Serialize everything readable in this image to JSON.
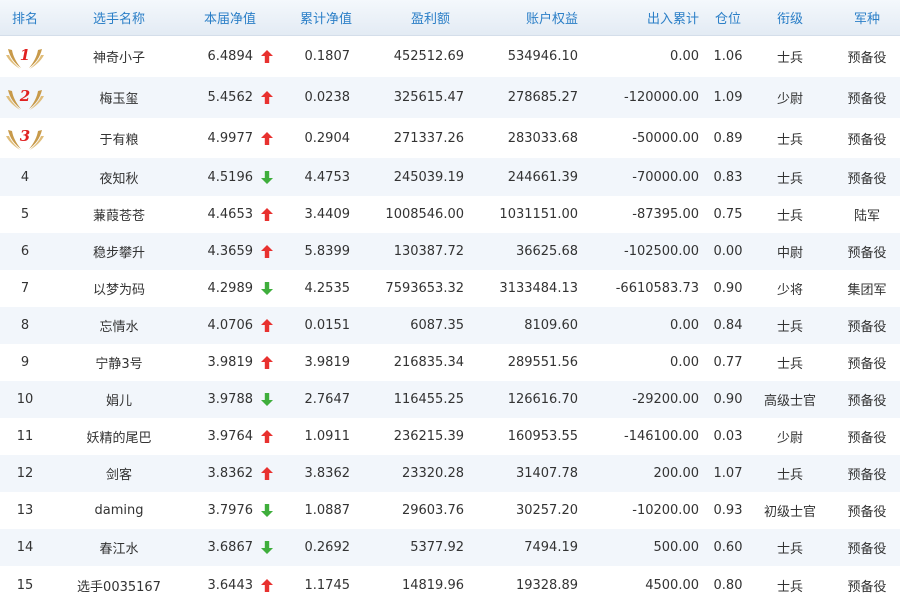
{
  "header": {
    "rank": "排名",
    "name": "选手名称",
    "nav": "本届净值",
    "cumulative_nav": "累计净值",
    "profit": "盈利额",
    "equity": "账户权益",
    "inout": "出入累计",
    "position": "仓位",
    "military_rank": "衔级",
    "army": "军种"
  },
  "colors": {
    "up": "#e8312f",
    "down": "#3fae3c",
    "header_text": "#2b7fc7",
    "medal_gold": "#c89a4a",
    "medal_number": "#e02020"
  },
  "rows": [
    {
      "rank": "1",
      "medal": true,
      "name": "神奇小子",
      "nav": "6.4894",
      "trend": "up",
      "cumulative_nav": "0.1807",
      "profit": "452512.69",
      "equity": "534946.10",
      "inout": "0.00",
      "position": "1.06",
      "military_rank": "士兵",
      "army": "预备役"
    },
    {
      "rank": "2",
      "medal": true,
      "name": "梅玉玺",
      "nav": "5.4562",
      "trend": "up",
      "cumulative_nav": "0.0238",
      "profit": "325615.47",
      "equity": "278685.27",
      "inout": "-120000.00",
      "position": "1.09",
      "military_rank": "少尉",
      "army": "预备役"
    },
    {
      "rank": "3",
      "medal": true,
      "name": "于有粮",
      "nav": "4.9977",
      "trend": "up",
      "cumulative_nav": "0.2904",
      "profit": "271337.26",
      "equity": "283033.68",
      "inout": "-50000.00",
      "position": "0.89",
      "military_rank": "士兵",
      "army": "预备役"
    },
    {
      "rank": "4",
      "medal": false,
      "name": "夜知秋",
      "nav": "4.5196",
      "trend": "down",
      "cumulative_nav": "4.4753",
      "profit": "245039.19",
      "equity": "244661.39",
      "inout": "-70000.00",
      "position": "0.83",
      "military_rank": "士兵",
      "army": "预备役"
    },
    {
      "rank": "5",
      "medal": false,
      "name": "蒹葭苍苍",
      "nav": "4.4653",
      "trend": "up",
      "cumulative_nav": "3.4409",
      "profit": "1008546.00",
      "equity": "1031151.00",
      "inout": "-87395.00",
      "position": "0.75",
      "military_rank": "士兵",
      "army": "陆军"
    },
    {
      "rank": "6",
      "medal": false,
      "name": "稳步攀升",
      "nav": "4.3659",
      "trend": "up",
      "cumulative_nav": "5.8399",
      "profit": "130387.72",
      "equity": "36625.68",
      "inout": "-102500.00",
      "position": "0.00",
      "military_rank": "中尉",
      "army": "预备役"
    },
    {
      "rank": "7",
      "medal": false,
      "name": "以梦为码",
      "nav": "4.2989",
      "trend": "down",
      "cumulative_nav": "4.2535",
      "profit": "7593653.32",
      "equity": "3133484.13",
      "inout": "-6610583.73",
      "position": "0.90",
      "military_rank": "少将",
      "army": "集团军"
    },
    {
      "rank": "8",
      "medal": false,
      "name": "忘情水",
      "nav": "4.0706",
      "trend": "up",
      "cumulative_nav": "0.0151",
      "profit": "6087.35",
      "equity": "8109.60",
      "inout": "0.00",
      "position": "0.84",
      "military_rank": "士兵",
      "army": "预备役"
    },
    {
      "rank": "9",
      "medal": false,
      "name": "宁静3号",
      "nav": "3.9819",
      "trend": "up",
      "cumulative_nav": "3.9819",
      "profit": "216835.34",
      "equity": "289551.56",
      "inout": "0.00",
      "position": "0.77",
      "military_rank": "士兵",
      "army": "预备役"
    },
    {
      "rank": "10",
      "medal": false,
      "name": "娟儿",
      "nav": "3.9788",
      "trend": "down",
      "cumulative_nav": "2.7647",
      "profit": "116455.25",
      "equity": "126616.70",
      "inout": "-29200.00",
      "position": "0.90",
      "military_rank": "高级士官",
      "army": "预备役"
    },
    {
      "rank": "11",
      "medal": false,
      "name": "妖精的尾巴",
      "nav": "3.9764",
      "trend": "up",
      "cumulative_nav": "1.0911",
      "profit": "236215.39",
      "equity": "160953.55",
      "inout": "-146100.00",
      "position": "0.03",
      "military_rank": "少尉",
      "army": "预备役"
    },
    {
      "rank": "12",
      "medal": false,
      "name": "剑客",
      "nav": "3.8362",
      "trend": "up",
      "cumulative_nav": "3.8362",
      "profit": "23320.28",
      "equity": "31407.78",
      "inout": "200.00",
      "position": "1.07",
      "military_rank": "士兵",
      "army": "预备役"
    },
    {
      "rank": "13",
      "medal": false,
      "name": "daming",
      "nav": "3.7976",
      "trend": "down",
      "cumulative_nav": "1.0887",
      "profit": "29603.76",
      "equity": "30257.20",
      "inout": "-10200.00",
      "position": "0.93",
      "military_rank": "初级士官",
      "army": "预备役"
    },
    {
      "rank": "14",
      "medal": false,
      "name": "春江水",
      "nav": "3.6867",
      "trend": "down",
      "cumulative_nav": "0.2692",
      "profit": "5377.92",
      "equity": "7494.19",
      "inout": "500.00",
      "position": "0.60",
      "military_rank": "士兵",
      "army": "预备役"
    },
    {
      "rank": "15",
      "medal": false,
      "name": "选手0035167",
      "nav": "3.6443",
      "trend": "up",
      "cumulative_nav": "1.1745",
      "profit": "14819.96",
      "equity": "19328.89",
      "inout": "4500.00",
      "position": "0.80",
      "military_rank": "士兵",
      "army": "预备役"
    }
  ]
}
